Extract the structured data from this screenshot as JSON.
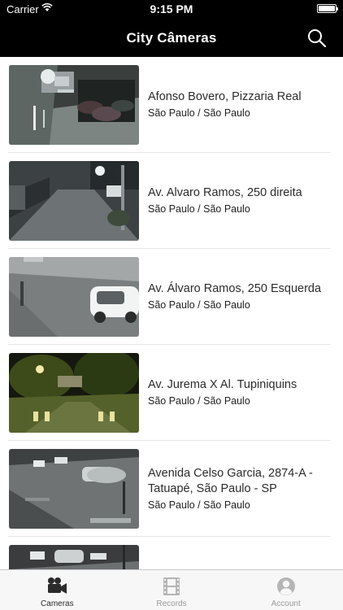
{
  "status_bar": {
    "carrier": "Carrier",
    "time": "9:15 PM",
    "battery_level": 1.0
  },
  "nav": {
    "title": "City Câmeras",
    "search_icon": "search-icon"
  },
  "cameras": [
    {
      "title": "Afonso Bovero, Pizzaria Real",
      "location": "São Paulo / São Paulo"
    },
    {
      "title": "Av. Alvaro Ramos, 250 direita",
      "location": "São Paulo / São Paulo"
    },
    {
      "title": "Av. Álvaro Ramos, 250 Esquerda",
      "location": "São Paulo / São Paulo"
    },
    {
      "title": "Av. Jurema X Al. Tupiniquins",
      "location": "São Paulo / São Paulo"
    },
    {
      "title": "Avenida Celso Garcia, 2874-A - Tatuapé, São Paulo - SP",
      "location": "São Paulo / São Paulo"
    },
    {
      "title": "",
      "location": ""
    }
  ],
  "tabs": [
    {
      "label": "Cameras",
      "icon": "video-camera-icon",
      "active": true
    },
    {
      "label": "Records",
      "icon": "film-icon",
      "active": false
    },
    {
      "label": "Account",
      "icon": "person-icon",
      "active": false
    }
  ]
}
